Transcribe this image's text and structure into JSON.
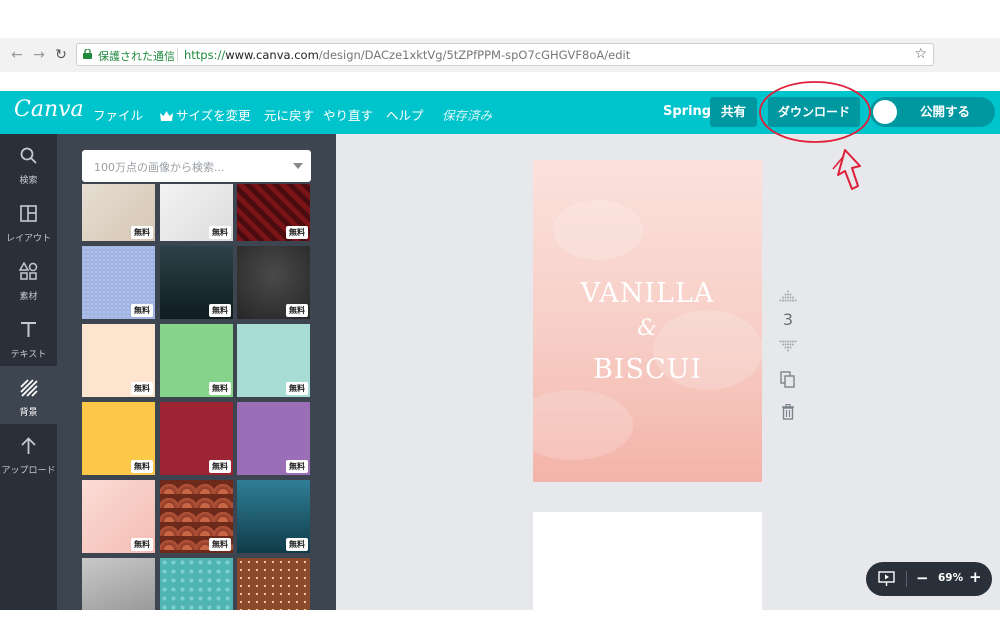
{
  "browser": {
    "secure_label": "保護された通信",
    "url_scheme": "https://",
    "url_domain": "www.canva.com",
    "url_path": "/design/DACze1xktVg/5tZPfPPM-spO7cGHGVF8oA/edit",
    "back_icon": "back-arrow-icon",
    "forward_icon": "forward-arrow-icon",
    "reload_icon": "reload-icon",
    "bookmark_icon": "star-icon"
  },
  "topbar": {
    "logo": "Canva",
    "menu": {
      "file": "ファイル",
      "resize": "サイズを変更",
      "undo": "元に戻す",
      "redo": "やり直す",
      "help": "ヘルプ",
      "saved": "保存済み"
    },
    "design_name": "Spring",
    "share": "共有",
    "download": "ダウンロード",
    "publish": "公開する",
    "accent_color": "#00c4cc",
    "button_color": "#0098a0",
    "annotation_color": "#e0203a"
  },
  "rail": {
    "items": [
      {
        "label": "検索",
        "icon": "search-icon"
      },
      {
        "label": "レイアウト",
        "icon": "layout-icon"
      },
      {
        "label": "素材",
        "icon": "elements-icon"
      },
      {
        "label": "テキスト",
        "icon": "text-icon"
      },
      {
        "label": "背景",
        "icon": "background-icon",
        "active": true
      },
      {
        "label": "アップロード",
        "icon": "upload-icon"
      }
    ]
  },
  "panel": {
    "search_placeholder": "100万点の画像から検索...",
    "free_badge": "無料"
  },
  "canvas": {
    "page1_title_line1": "VANILLA",
    "page1_title_amp": "&",
    "page1_title_line2": "BISCUI",
    "page_number": "3"
  },
  "zoom": {
    "minus": "−",
    "value": "69%",
    "plus": "+"
  }
}
